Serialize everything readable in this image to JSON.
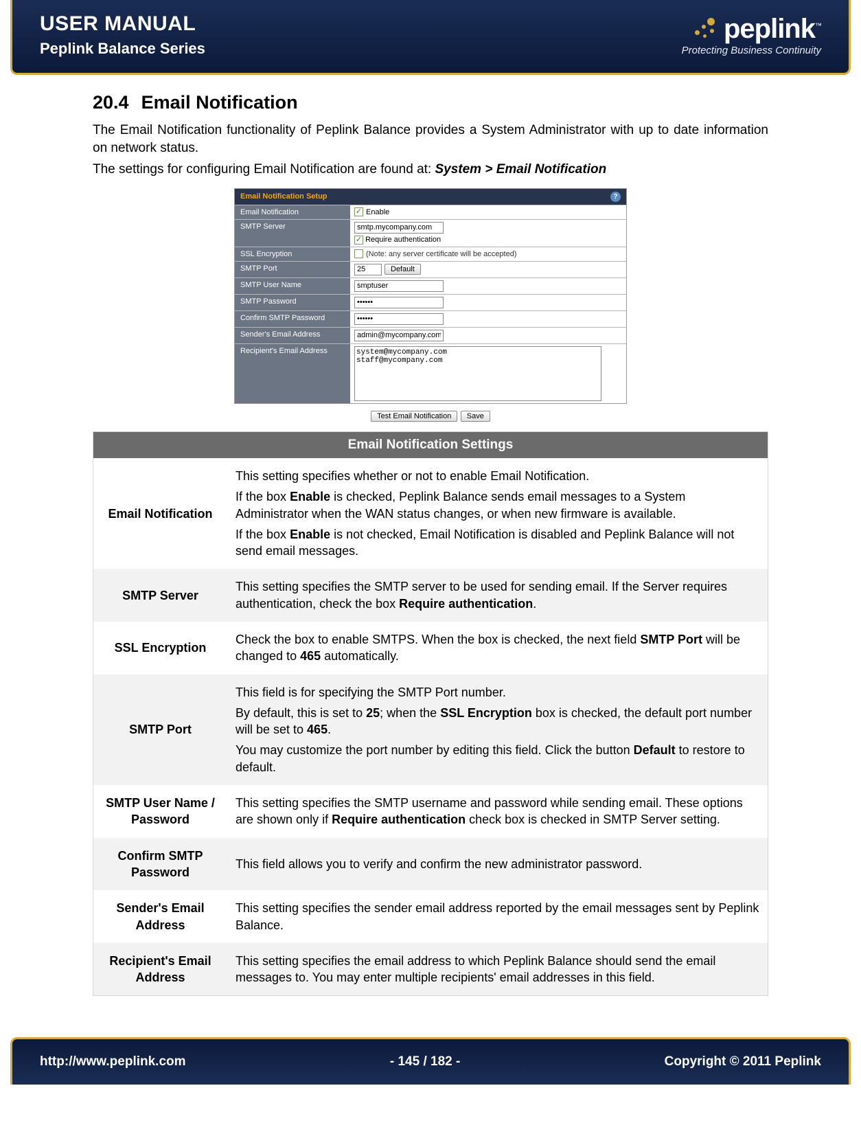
{
  "header": {
    "title": "USER MANUAL",
    "subtitle": "Peplink Balance Series",
    "logo_text": "peplink",
    "logo_tagline": "Protecting Business Continuity"
  },
  "section": {
    "number": "20.4",
    "title": "Email Notification",
    "para1": "The Email Notification functionality of Peplink Balance provides a System Administrator with up to date information on network status.",
    "para2_prefix": "The settings for configuring Email Notification are found at: ",
    "para2_path": "System > Email Notification"
  },
  "screenshot": {
    "panel_title": "Email Notification Setup",
    "rows": {
      "email_notification": {
        "label": "Email Notification",
        "enable": "Enable"
      },
      "smtp_server": {
        "label": "SMTP Server",
        "value": "smtp.mycompany.com",
        "require_auth": "Require authentication"
      },
      "ssl": {
        "label": "SSL Encryption",
        "note": "(Note: any server certificate will be accepted)"
      },
      "port": {
        "label": "SMTP Port",
        "value": "25",
        "default_btn": "Default"
      },
      "user": {
        "label": "SMTP User Name",
        "value": "smptuser"
      },
      "pass": {
        "label": "SMTP Password",
        "value": "••••••"
      },
      "confirm": {
        "label": "Confirm SMTP Password",
        "value": "••••••"
      },
      "sender": {
        "label": "Sender's Email Address",
        "value": "admin@mycompany.com"
      },
      "recipient": {
        "label": "Recipient's Email Address",
        "value": "system@mycompany.com\nstaff@mycompany.com"
      }
    },
    "actions": {
      "test": "Test Email Notification",
      "save": "Save"
    }
  },
  "settings_table": {
    "header": "Email Notification Settings",
    "rows": [
      {
        "name": "Email Notification",
        "html": "<p>This setting specifies whether or not to enable Email Notification.</p><p>If the box <b>Enable</b> is checked, Peplink Balance sends email messages to a System Administrator when the WAN status changes, or when new firmware is available.</p><p>If the box <b>Enable</b> is not checked, Email Notification is disabled and Peplink Balance will not send email messages.</p>"
      },
      {
        "name": "SMTP Server",
        "html": "This setting specifies the SMTP server to be used for sending email.  If the Server requires authentication, check the box <b>Require authentication</b>."
      },
      {
        "name": "SSL Encryption",
        "html": "Check the box to enable SMTPS.  When the box is checked, the next field <b>SMTP Port</b> will be changed to <b>465</b> automatically."
      },
      {
        "name": "SMTP Port",
        "html": "<p>This field is for specifying the SMTP Port number.</p><p>By default, this is set to <b>25</b>; when the <b>SSL Encryption</b> box is checked, the default port number will be set to <b>465</b>.</p><p>You may customize the port number by editing this field.  Click the button <b>Default</b> to restore to default.</p>"
      },
      {
        "name": "SMTP User Name / Password",
        "html": "This setting specifies the SMTP username and password while sending email.  These options are shown only if <b>Require authentication</b> check box is checked in SMTP Server setting."
      },
      {
        "name": "Confirm SMTP Password",
        "html": "This field allows you to verify and confirm the new administrator password."
      },
      {
        "name": "Sender's Email Address",
        "html": "This setting specifies the sender email address reported by the email messages sent by Peplink Balance."
      },
      {
        "name": "Recipient's Email Address",
        "html": "This setting specifies the email address to which Peplink Balance should send the email messages to.  You may enter multiple recipients' email addresses in this field."
      }
    ]
  },
  "footer": {
    "url": "http://www.peplink.com",
    "page": "- 145 / 182 -",
    "copyright": "Copyright © 2011 Peplink"
  }
}
